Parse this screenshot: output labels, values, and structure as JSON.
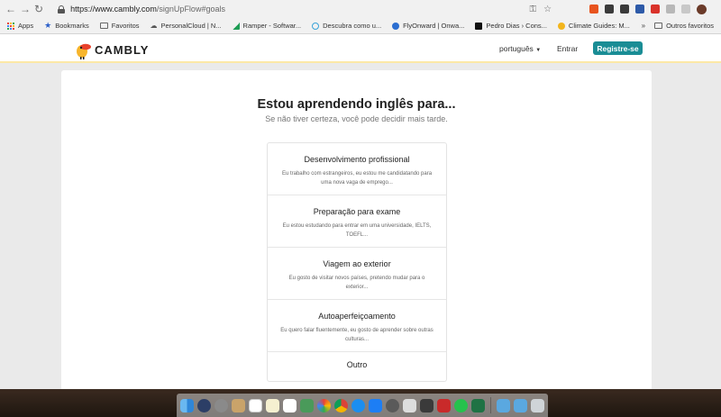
{
  "browser": {
    "url_host": "https://www.cambly.com",
    "url_path": "/signUpFlow#goals",
    "bookmarks": [
      {
        "label": "Apps",
        "icon": "apps-grid-icon"
      },
      {
        "label": "Bookmarks",
        "icon": "star-icon"
      },
      {
        "label": "Favoritos",
        "icon": "folder-icon"
      },
      {
        "label": "PersonalCloud | N...",
        "icon": "cloud-icon"
      },
      {
        "label": "Ramper - Softwar...",
        "icon": "ramper-icon"
      },
      {
        "label": "Descubra como u...",
        "icon": "globe-icon"
      },
      {
        "label": "FlyOnward | Onwa...",
        "icon": "flyonward-icon"
      },
      {
        "label": "Pedro Dias › Cons...",
        "icon": "medium-icon"
      },
      {
        "label": "Climate Guides: M...",
        "icon": "climate-icon"
      }
    ],
    "other_bookmarks": "Outros favoritos"
  },
  "header": {
    "logo_text": "CAMBLY",
    "language": "português",
    "login": "Entrar",
    "signup": "Registre-se"
  },
  "main": {
    "title": "Estou aprendendo inglês para...",
    "subtitle": "Se não tiver certeza, você pode decidir mais tarde.",
    "options": [
      {
        "title": "Desenvolvimento profissional",
        "desc": "Eu trabalho com estrangeiros, eu estou me candidatando para uma nova vaga de emprego..."
      },
      {
        "title": "Preparação para exame",
        "desc": "Eu estou estudando para entrar em uma universidade, IELTS, TOEFL..."
      },
      {
        "title": "Viagem ao exterior",
        "desc": "Eu gosto de visitar novos países, pretendo mudar para o exterior..."
      },
      {
        "title": "Autoaperfeiçoamento",
        "desc": "Eu quero falar fluentemente, eu gosto de aprender sobre outras culturas..."
      },
      {
        "title": "Outro",
        "desc": ""
      }
    ]
  },
  "colors": {
    "brand_teal": "#1a8d95",
    "header_border": "#fce8a6"
  }
}
